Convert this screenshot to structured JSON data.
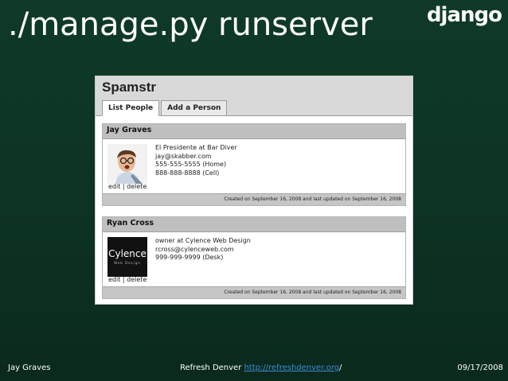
{
  "slide": {
    "title": "./manage.py runserver",
    "logo": "django",
    "footer_left": "Jay Graves",
    "footer_center_prefix": "Refresh Denver ",
    "footer_center_link": "http://refreshdenver.org",
    "footer_center_suffix": "/",
    "footer_right": "09/17/2008"
  },
  "app": {
    "name": "Spamstr",
    "tabs": [
      {
        "label": "List People",
        "active": true
      },
      {
        "label": "Add a Person",
        "active": false
      }
    ]
  },
  "people": [
    {
      "name": "Jay Graves",
      "lines": [
        "El Presidente at Bar Diver",
        "jay@skabber.com",
        "555-555-5555 (Home)",
        "888-888-8888 (Cell)"
      ],
      "edit": "edit",
      "sep": "|",
      "delete": "delete",
      "meta": "Created on September 16, 2008 and last updated on September 16, 2008"
    },
    {
      "name": "Ryan Cross",
      "lines": [
        "owner at Cylence Web Design",
        "rcross@cylenceweb.com",
        "999-999-9999 (Desk)"
      ],
      "edit": "edit",
      "sep": "|",
      "delete": "delete",
      "meta": "Created on September 16, 2008 and last updated on September 16, 2008",
      "logo_text": "Cylence",
      "logo_subtext": "Web Design"
    }
  ],
  "colors": {
    "background": "#0d3322",
    "link": "#3d8ad6",
    "card_header": "#bfbfbf",
    "app_header": "#d9d9d9"
  }
}
